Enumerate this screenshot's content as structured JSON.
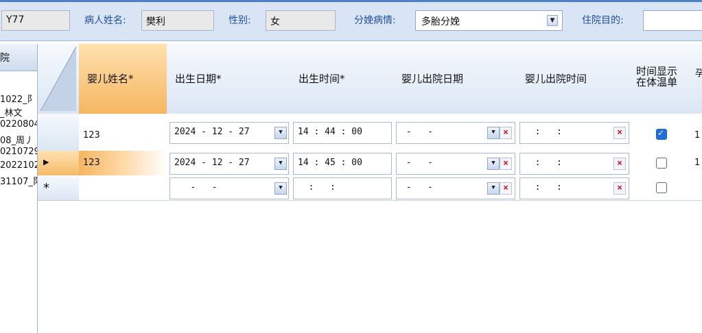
{
  "top": {
    "record_no": "Y77",
    "patient_name_label": "病人姓名:",
    "patient_name": "樊利",
    "gender_label": "性别:",
    "gender": "女",
    "delivery_label": "分娩病情:",
    "delivery_value": "多胎分娩",
    "purpose_label": "住院目的:",
    "purpose_value": ""
  },
  "left": {
    "header": "院",
    "items": [
      "1022_阝",
      "_林文",
      "0220804",
      "08_周丿",
      "0210729",
      "2022102",
      "31107_阝"
    ]
  },
  "grid": {
    "columns": [
      "婴儿姓名*",
      "出生日期*",
      "出生时间*",
      "婴儿出院日期",
      "婴儿出院时间",
      "时间显示在体温单",
      "孕次"
    ],
    "col7_label": "孕\n次",
    "col6_line1": "时间显示",
    "col6_line2": "在体温单",
    "rows": [
      {
        "name": "123",
        "birth_date": "2024 - 12 - 27",
        "birth_time": "14 : 44 : 00",
        "discharge_date": " -   - ",
        "discharge_time": "  :   :",
        "show_temp": true,
        "extra": "1"
      },
      {
        "name": "123",
        "birth_date": "2024 - 12 - 27",
        "birth_time": "14 : 45 : 00",
        "discharge_date": " -   - ",
        "discharge_time": "  :   :",
        "show_temp": false,
        "extra": "1"
      },
      {
        "name": "",
        "birth_date": "   -   - ",
        "birth_time": "  :   :",
        "discharge_date": " -   - ",
        "discharge_time": "  :   :",
        "show_temp": false,
        "extra": ""
      }
    ],
    "new_row_marker": "*",
    "current_row_marker": "▶"
  }
}
